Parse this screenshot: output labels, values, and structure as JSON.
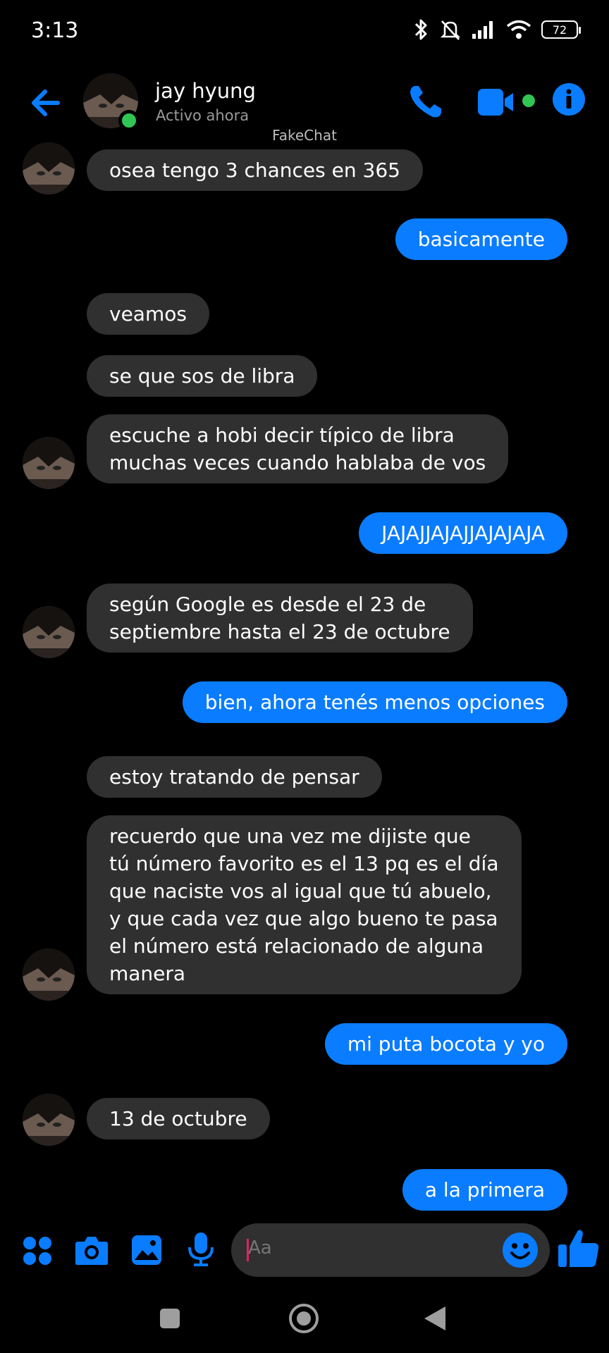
{
  "status_bar": {
    "time": "3:13",
    "battery": "72"
  },
  "header": {
    "name": "jay hyung",
    "status": "Activo ahora",
    "watermark": "FakeChat"
  },
  "colors": {
    "accent": "#0a7cff",
    "incoming_bubble": "#303030",
    "online": "#31c553",
    "background": "#000000"
  },
  "messages": [
    {
      "side": "in",
      "lines": [
        "osea tengo 3 chances en 365"
      ],
      "avatar": true
    },
    {
      "side": "out",
      "lines": [
        "basicamente"
      ]
    },
    {
      "side": "in",
      "lines": [
        "veamos"
      ]
    },
    {
      "side": "in",
      "lines": [
        "se que sos de libra"
      ]
    },
    {
      "side": "in",
      "lines": [
        "escuche a hobi decir típico de libra",
        "muchas veces cuando hablaba de vos"
      ],
      "avatar": true
    },
    {
      "side": "out",
      "lines": [
        "JAJAJJAJAJJAJAJAJA"
      ]
    },
    {
      "side": "in",
      "lines": [
        "según Google es desde el 23 de",
        "septiembre hasta el 23 de octubre"
      ],
      "avatar": true
    },
    {
      "side": "out",
      "lines": [
        "bien, ahora tenés menos opciones"
      ]
    },
    {
      "side": "in",
      "lines": [
        "estoy tratando de pensar"
      ]
    },
    {
      "side": "in",
      "lines": [
        "recuerdo que una vez me dijiste que",
        "tú número favorito es el 13 pq es el día",
        "que naciste vos al igual que tú abuelo,",
        "y que cada vez que algo bueno te pasa",
        "el número está relacionado de alguna",
        "manera"
      ],
      "avatar": true
    },
    {
      "side": "out",
      "lines": [
        "mi puta bocota y yo"
      ]
    },
    {
      "side": "in",
      "lines": [
        "13 de octubre"
      ],
      "avatar": true
    },
    {
      "side": "out",
      "lines": [
        "a la primera"
      ]
    }
  ],
  "composer": {
    "placeholder": "Aa"
  },
  "icons": {
    "header": [
      "back-arrow-icon",
      "phone-icon",
      "video-camera-icon",
      "info-icon"
    ],
    "composer": [
      "apps-grid-icon",
      "camera-icon",
      "image-icon",
      "microphone-icon",
      "emoji-icon",
      "thumbs-up-icon"
    ],
    "navbar": [
      "recents-square-icon",
      "home-circle-icon",
      "back-triangle-icon"
    ]
  }
}
